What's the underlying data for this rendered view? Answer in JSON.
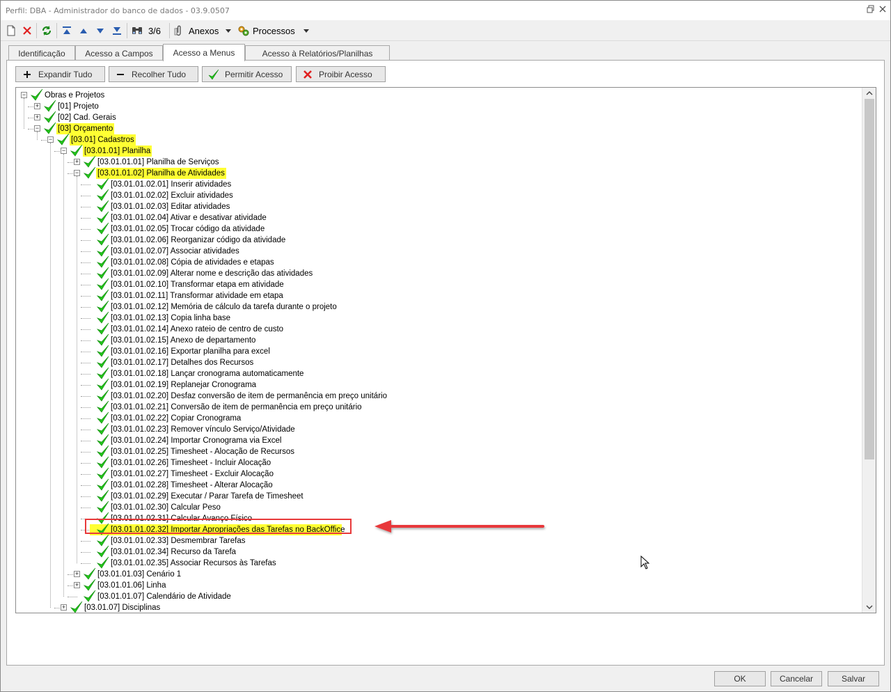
{
  "window": {
    "title": "Perfil: DBA - Administrador do banco de dados - 03.9.0507"
  },
  "toolbar": {
    "record_counter": "3/6",
    "attachments_label": "Anexos",
    "processes_label": "Processos",
    "icons": [
      "new-icon",
      "delete-icon",
      "refresh-icon",
      "first-record-icon",
      "previous-record-icon",
      "next-record-icon",
      "last-record-icon",
      "binoculars-icon",
      "paperclip-icon",
      "gears-icon"
    ]
  },
  "tabs": [
    {
      "label": "Identificação",
      "active": false
    },
    {
      "label": "Acesso a Campos",
      "active": false
    },
    {
      "label": "Acesso a Menus",
      "active": true
    },
    {
      "label": "Acesso à Relatórios/Planilhas",
      "active": false
    }
  ],
  "actions": {
    "expand_all": "Expandir Tudo",
    "collapse_all": "Recolher Tudo",
    "allow_access": "Permitir Acesso",
    "deny_access": "Proibir Acesso"
  },
  "tree": [
    {
      "label": "Obras e Projetos",
      "depth": 0,
      "expander": "-",
      "highlight": false
    },
    {
      "label": "[01] Projeto",
      "depth": 1,
      "expander": "+",
      "highlight": false
    },
    {
      "label": "[02] Cad. Gerais",
      "depth": 1,
      "expander": "+",
      "highlight": false
    },
    {
      "label": "[03] Orçamento",
      "depth": 1,
      "expander": "-",
      "highlight": true
    },
    {
      "label": "[03.01] Cadastros",
      "depth": 2,
      "expander": "-",
      "highlight": true
    },
    {
      "label": "[03.01.01] Planilha",
      "depth": 3,
      "expander": "-",
      "highlight": true
    },
    {
      "label": "[03.01.01.01] Planilha de Serviços",
      "depth": 4,
      "expander": "+",
      "highlight": false
    },
    {
      "label": "[03.01.01.02] Planilha de Atividades",
      "depth": 4,
      "expander": "-",
      "highlight": true
    },
    {
      "label": "[03.01.01.02.01] Inserir atividades",
      "depth": 5,
      "expander": "",
      "highlight": false
    },
    {
      "label": "[03.01.01.02.02] Excluir atividades",
      "depth": 5,
      "expander": "",
      "highlight": false
    },
    {
      "label": "[03.01.01.02.03] Editar atividades",
      "depth": 5,
      "expander": "",
      "highlight": false
    },
    {
      "label": "[03.01.01.02.04] Ativar e desativar atividade",
      "depth": 5,
      "expander": "",
      "highlight": false
    },
    {
      "label": "[03.01.01.02.05] Trocar código da atividade",
      "depth": 5,
      "expander": "",
      "highlight": false
    },
    {
      "label": "[03.01.01.02.06] Reorganizar código da atividade",
      "depth": 5,
      "expander": "",
      "highlight": false
    },
    {
      "label": "[03.01.01.02.07] Associar atividades",
      "depth": 5,
      "expander": "",
      "highlight": false
    },
    {
      "label": "[03.01.01.02.08] Cópia de atividades e etapas",
      "depth": 5,
      "expander": "",
      "highlight": false
    },
    {
      "label": "[03.01.01.02.09] Alterar nome e descrição das atividades",
      "depth": 5,
      "expander": "",
      "highlight": false
    },
    {
      "label": "[03.01.01.02.10] Transformar etapa em atividade",
      "depth": 5,
      "expander": "",
      "highlight": false
    },
    {
      "label": "[03.01.01.02.11] Transformar atividade em etapa",
      "depth": 5,
      "expander": "",
      "highlight": false
    },
    {
      "label": "[03.01.01.02.12] Memória de cálculo da tarefa durante o projeto",
      "depth": 5,
      "expander": "",
      "highlight": false
    },
    {
      "label": "[03.01.01.02.13] Copia linha base",
      "depth": 5,
      "expander": "",
      "highlight": false
    },
    {
      "label": "[03.01.01.02.14] Anexo rateio de centro de  custo",
      "depth": 5,
      "expander": "",
      "highlight": false
    },
    {
      "label": "[03.01.01.02.15] Anexo de departamento",
      "depth": 5,
      "expander": "",
      "highlight": false
    },
    {
      "label": "[03.01.01.02.16] Exportar planilha para excel",
      "depth": 5,
      "expander": "",
      "highlight": false
    },
    {
      "label": "[03.01.01.02.17] Detalhes dos Recursos",
      "depth": 5,
      "expander": "",
      "highlight": false
    },
    {
      "label": "[03.01.01.02.18] Lançar cronograma automaticamente",
      "depth": 5,
      "expander": "",
      "highlight": false
    },
    {
      "label": "[03.01.01.02.19] Replanejar Cronograma",
      "depth": 5,
      "expander": "",
      "highlight": false
    },
    {
      "label": "[03.01.01.02.20] Desfaz conversão de item de permanência em preço unitário",
      "depth": 5,
      "expander": "",
      "highlight": false
    },
    {
      "label": "[03.01.01.02.21] Conversão de item de permanência em preço unitário",
      "depth": 5,
      "expander": "",
      "highlight": false
    },
    {
      "label": "[03.01.01.02.22] Copiar Cronograma",
      "depth": 5,
      "expander": "",
      "highlight": false
    },
    {
      "label": "[03.01.01.02.23] Remover vínculo Serviço/Atividade",
      "depth": 5,
      "expander": "",
      "highlight": false
    },
    {
      "label": "[03.01.01.02.24] Importar Cronograma via Excel",
      "depth": 5,
      "expander": "",
      "highlight": false
    },
    {
      "label": "[03.01.01.02.25] Timesheet - Alocação de Recursos",
      "depth": 5,
      "expander": "",
      "highlight": false
    },
    {
      "label": "[03.01.01.02.26] Timesheet - Incluir Alocação",
      "depth": 5,
      "expander": "",
      "highlight": false
    },
    {
      "label": "[03.01.01.02.27] Timesheet - Excluir Alocação",
      "depth": 5,
      "expander": "",
      "highlight": false
    },
    {
      "label": "[03.01.01.02.28] Timesheet - Alterar Alocação",
      "depth": 5,
      "expander": "",
      "highlight": false
    },
    {
      "label": "[03.01.01.02.29] Executar / Parar Tarefa de Timesheet",
      "depth": 5,
      "expander": "",
      "highlight": false
    },
    {
      "label": "[03.01.01.02.30] Calcular Peso",
      "depth": 5,
      "expander": "",
      "highlight": false
    },
    {
      "label": "[03.01.01.02.31] Calcular Avanço Físico",
      "depth": 5,
      "expander": "",
      "highlight": false
    },
    {
      "label": "[03.01.01.02.32] Importar Apropriações das Tarefas no BackOffice",
      "depth": 5,
      "expander": "",
      "highlight": true,
      "row_highlight": true
    },
    {
      "label": "[03.01.01.02.33] Desmembrar Tarefas",
      "depth": 5,
      "expander": "",
      "highlight": false
    },
    {
      "label": "[03.01.01.02.34] Recurso da Tarefa",
      "depth": 5,
      "expander": "",
      "highlight": false
    },
    {
      "label": "[03.01.01.02.35] Associar Recursos às Tarefas",
      "depth": 5,
      "expander": "",
      "highlight": false
    },
    {
      "label": "[03.01.01.03] Cenário 1",
      "depth": 4,
      "expander": "+",
      "highlight": false
    },
    {
      "label": "[03.01.01.06] Linha",
      "depth": 4,
      "expander": "+",
      "highlight": false
    },
    {
      "label": "[03.01.01.07] Calendário de Atividade",
      "depth": 4,
      "expander": "",
      "highlight": false
    },
    {
      "label": "[03.01.07] Disciplinas",
      "depth": 3,
      "expander": "+",
      "highlight": false
    }
  ],
  "footer": {
    "ok": "OK",
    "cancel": "Cancelar",
    "save": "Salvar"
  },
  "colors": {
    "highlight": "#ffff33",
    "check": "#22c41a",
    "annotation": "#e8393a"
  }
}
